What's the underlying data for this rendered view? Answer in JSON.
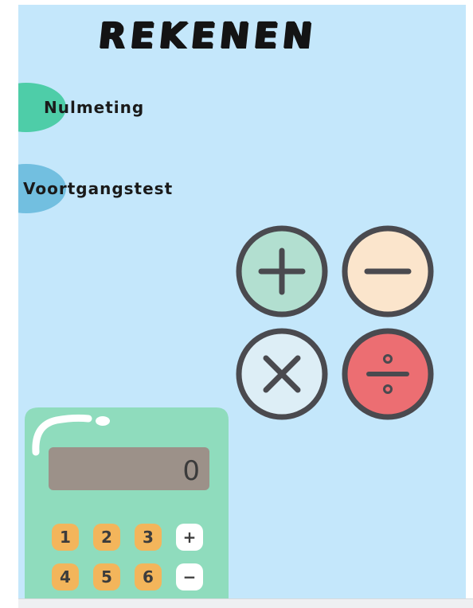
{
  "header": {
    "title": "REKENEN"
  },
  "nav": {
    "items": [
      {
        "label": "Nulmeting",
        "color": "#4ecda8"
      },
      {
        "label": "Voortgangstest",
        "color": "#72bfe0"
      }
    ]
  },
  "operations": [
    {
      "name": "plus",
      "icon": "plus-icon",
      "fill": "#b2dfd0"
    },
    {
      "name": "minus",
      "icon": "minus-icon",
      "fill": "#fbe5cc"
    },
    {
      "name": "times",
      "icon": "times-icon",
      "fill": "#ddeef6"
    },
    {
      "name": "divide",
      "icon": "divide-icon",
      "fill": "#ec6e72"
    }
  ],
  "calculator": {
    "display": "0",
    "keys_row1": [
      "1",
      "2",
      "3",
      "+"
    ],
    "keys_row2": [
      "4",
      "5",
      "6",
      "−"
    ],
    "body_color": "#8fdcbd",
    "key_color": "#f3b55b"
  },
  "colors": {
    "background": "#c4e7fb",
    "stroke": "#4a4a4f"
  }
}
